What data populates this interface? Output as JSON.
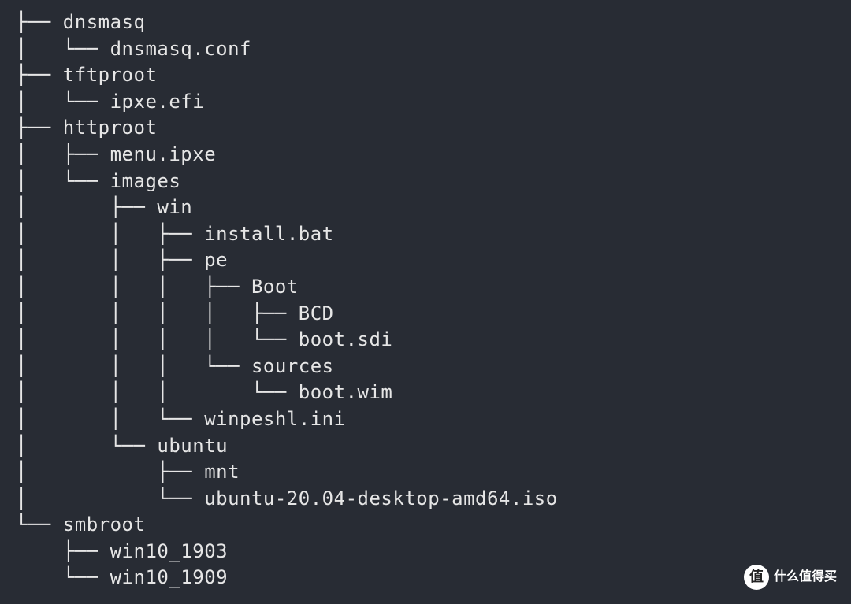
{
  "tree": {
    "lines": [
      "├── dnsmasq",
      "│   └── dnsmasq.conf",
      "├── tftproot",
      "│   └── ipxe.efi",
      "├── httproot",
      "│   ├── menu.ipxe",
      "│   └── images",
      "│       ├── win",
      "│       │   ├── install.bat",
      "│       │   ├── pe",
      "│       │   │   ├── Boot",
      "│       │   │   │   ├── BCD",
      "│       │   │   │   └── boot.sdi",
      "│       │   │   └── sources",
      "│       │   │       └── boot.wim",
      "│       │   └── winpeshl.ini",
      "│       └── ubuntu",
      "│           ├── mnt",
      "│           └── ubuntu-20.04-desktop-amd64.iso",
      "└── smbroot",
      "    ├── win10_1903",
      "    └── win10_1909"
    ]
  },
  "watermark": {
    "badge": "值",
    "text": "什么值得买"
  }
}
